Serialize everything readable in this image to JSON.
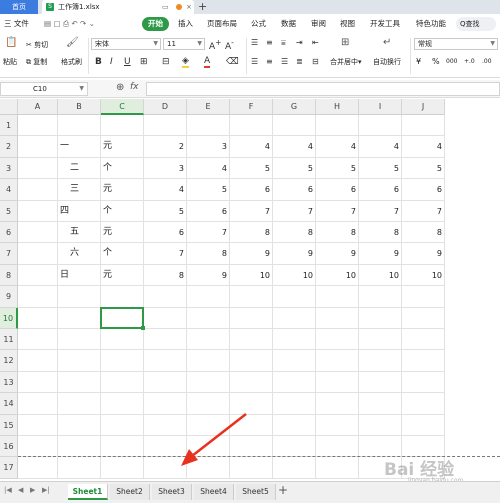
{
  "tabs": {
    "home": "首页",
    "file": "工作簿1.xlsx",
    "new_tab": "+"
  },
  "menu": {
    "file": "三 文件",
    "items": [
      "开始",
      "插入",
      "页面布局",
      "公式",
      "数据",
      "审阅",
      "视图",
      "开发工具",
      "特色功能"
    ],
    "active": "开始",
    "search": "Q查找"
  },
  "ribbon": {
    "paste": "粘贴",
    "cut": "剪切",
    "copy": "复制",
    "format_painter": "格式刷",
    "font_name": "宋体",
    "font_size": "11",
    "merge": "合并居中",
    "wrap": "自动换行",
    "number_format": "常规",
    "currency": "¥",
    "percent": "%",
    "thousands": "000",
    "dec_inc": "+.0",
    "dec_dec": ".00"
  },
  "formula_bar": {
    "cell_ref": "C10",
    "fx": "fx",
    "value": ""
  },
  "columns": [
    "A",
    "B",
    "C",
    "D",
    "E",
    "F",
    "G",
    "H",
    "I",
    "J"
  ],
  "rows": [
    "1",
    "2",
    "3",
    "4",
    "5",
    "6",
    "7",
    "8",
    "9",
    "10",
    "11",
    "12",
    "13",
    "14",
    "15",
    "16",
    "17"
  ],
  "selected_cell": {
    "col": "C",
    "row": "10"
  },
  "cells": [
    {
      "row": 2,
      "B": "一",
      "C": "元",
      "D": "2",
      "E": "3",
      "F": "4",
      "G": "4",
      "H": "4",
      "I": "4",
      "J": "4"
    },
    {
      "row": 3,
      "B": "二",
      "C": "个",
      "D": "3",
      "E": "4",
      "F": "5",
      "G": "5",
      "H": "5",
      "I": "5",
      "J": "5"
    },
    {
      "row": 4,
      "B": "三",
      "C": "元",
      "D": "4",
      "E": "5",
      "F": "6",
      "G": "6",
      "H": "6",
      "I": "6",
      "J": "6"
    },
    {
      "row": 5,
      "B": "四",
      "C": "个",
      "D": "5",
      "E": "6",
      "F": "7",
      "G": "7",
      "H": "7",
      "I": "7",
      "J": "7"
    },
    {
      "row": 6,
      "B": "五",
      "C": "元",
      "D": "6",
      "E": "7",
      "F": "8",
      "G": "8",
      "H": "8",
      "I": "8",
      "J": "8"
    },
    {
      "row": 7,
      "B": "六",
      "C": "个",
      "D": "7",
      "E": "8",
      "F": "9",
      "G": "9",
      "H": "9",
      "I": "9",
      "J": "9"
    },
    {
      "row": 8,
      "B": "日",
      "C": "元",
      "D": "8",
      "E": "9",
      "F": "10",
      "G": "10",
      "H": "10",
      "I": "10",
      "J": "10"
    }
  ],
  "sheets": [
    "Sheet1",
    "Sheet2",
    "Sheet3",
    "Sheet4",
    "Sheet5"
  ],
  "active_sheet": "Sheet1",
  "add_sheet": "+",
  "watermark": "Bai 经验",
  "watermark_sub": "jingyan.baidu.com",
  "colors": {
    "accent": "#2e9a47",
    "home_tab": "#3c7be0",
    "annotation": "#e8321e"
  }
}
